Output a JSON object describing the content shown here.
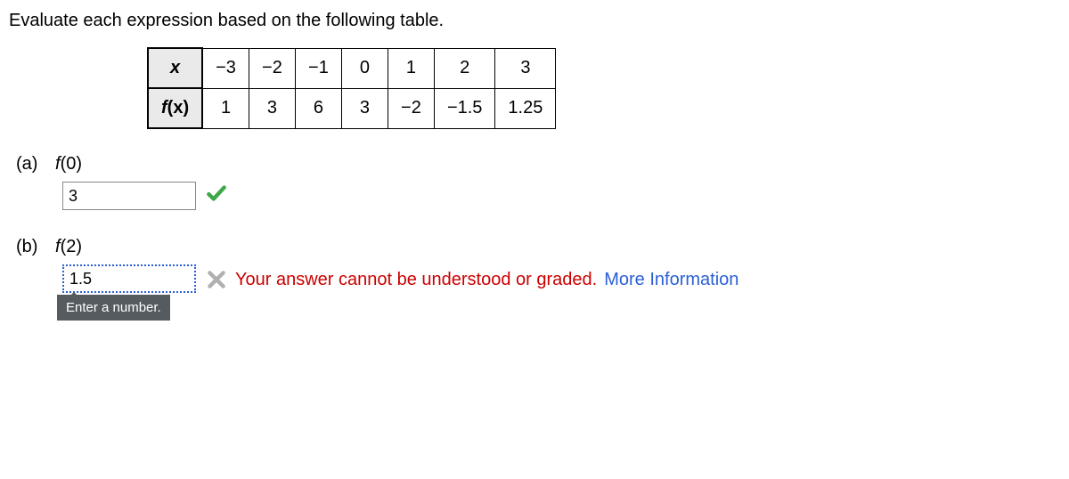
{
  "prompt": "Evaluate each expression based on the following table.",
  "table": {
    "row_headers": {
      "x": "x",
      "fx_f": "f",
      "fx_paren": "(x)"
    },
    "x_vals": [
      "−3",
      "−2",
      "−1",
      "0",
      "1",
      "2",
      "3"
    ],
    "fx_vals": [
      "1",
      "3",
      "6",
      "3",
      "−2",
      "−1.5",
      "1.25"
    ]
  },
  "parts": {
    "a": {
      "letter": "(a)",
      "fn": "f",
      "arg": "(0)",
      "value": "3"
    },
    "b": {
      "letter": "(b)",
      "fn": "f",
      "arg": "(2)",
      "value": "1.5",
      "tooltip": "Enter a number.",
      "error": "Your answer cannot be understood or graded.",
      "more": "More Information"
    }
  }
}
